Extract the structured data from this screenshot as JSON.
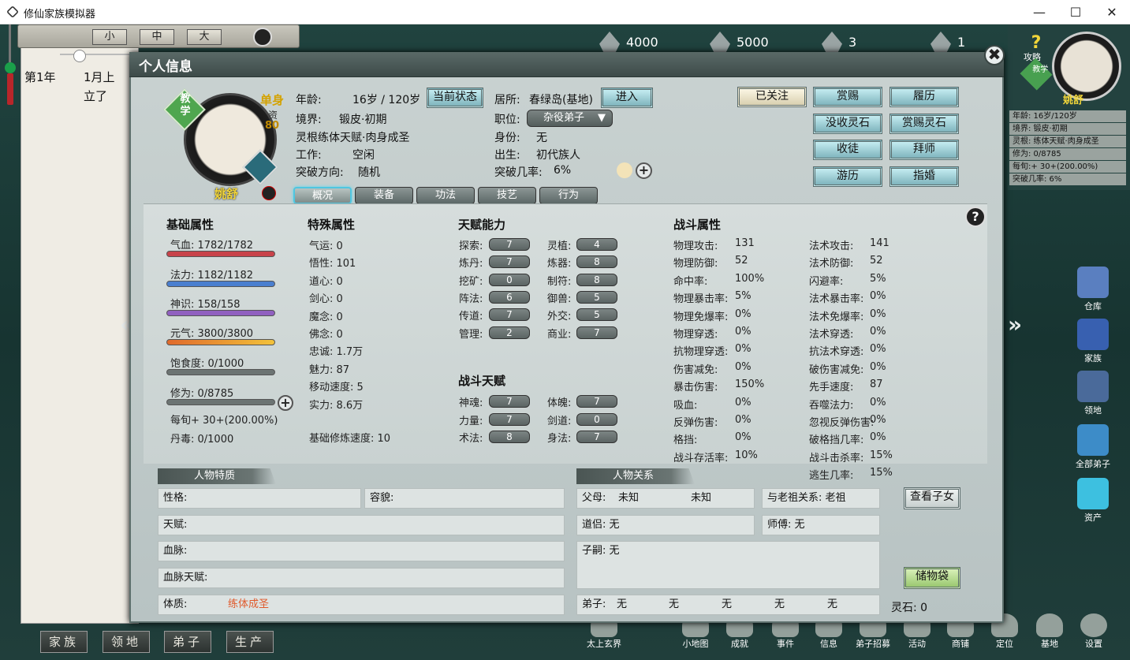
{
  "window": {
    "title": "修仙家族模拟器",
    "min": "—",
    "max": "☐",
    "close": "✕"
  },
  "scroll_sizes": [
    "小",
    "中",
    "大"
  ],
  "log": {
    "year": "第1年",
    "month": "1月上",
    "line2": "立了"
  },
  "bottom_tabs": [
    "家族",
    "领地",
    "弟子",
    "生产"
  ],
  "resources": [
    "4000",
    "5000",
    "3",
    "1"
  ],
  "right_panel": {
    "guide": "攻略",
    "teach": "教学",
    "name": "姚舒",
    "rows": [
      "年龄: 16岁/120岁",
      "境界: 锻皮·初期",
      "灵根: 练体天赋·肉身成圣",
      "修为: 0/8785",
      "每旬:+ 30+(200.00%)",
      "突破几率: 6%"
    ],
    "buttons": [
      "仓库",
      "家族",
      "领地",
      "全部弟子",
      "资产"
    ]
  },
  "bottom_nav": [
    "太上玄界",
    "小地图",
    "成就",
    "事件",
    "信息",
    "弟子招募",
    "活动",
    "商铺",
    "定位",
    "基地",
    "设置"
  ],
  "dialog": {
    "title": "个人信息",
    "close": "✖",
    "portrait": {
      "teach": "教学",
      "marital": "单身",
      "talent_label": "资",
      "talent": "80",
      "name": "姚舒"
    },
    "info": {
      "age_label": "年龄:",
      "age": "16岁 / 120岁",
      "realm_label": "境界:",
      "realm": "锻皮·初期",
      "root": "灵根练体天赋·肉身成圣",
      "work_label": "工作:",
      "work": "空闲",
      "direction_label": "突破方向:",
      "direction": "随机",
      "home_label": "居所:",
      "home": "春绿岛(基地)",
      "post_label": "职位:",
      "post": "杂役弟子",
      "identity_label": "身份:",
      "identity": "无",
      "birth_label": "出生:",
      "birth": "初代族人",
      "chance_label": "突破几率:",
      "chance": "6%"
    },
    "btn_status": "当前状态",
    "btn_enter": "进入",
    "actions": [
      "已关注",
      "赏赐",
      "履历",
      "没收灵石",
      "赏赐灵石",
      "收徒",
      "拜师",
      "游历",
      "指婚"
    ],
    "tabs": [
      "概况",
      "装备",
      "功法",
      "技艺",
      "行为"
    ],
    "help": "?",
    "basic": {
      "title": "基础属性",
      "hp": "气血: 1782/1782",
      "mp": "法力: 1182/1182",
      "sense": "神识: 158/158",
      "vital": "元气: 3800/3800",
      "food": "饱食度: 0/1000",
      "cult": "修为: 0/8785",
      "per": "每旬+ 30+(200.00%)",
      "poison": "丹毒: 0/1000",
      "bar_fill": {
        "hp": 1,
        "mp": 1,
        "sense": 1,
        "vital": 1,
        "food": 0,
        "cult": 0
      }
    },
    "special": {
      "title": "特殊属性",
      "rows": [
        "气运: 0",
        "悟性: 101",
        "道心: 0",
        "剑心: 0",
        "魔念: 0",
        "佛念: 0",
        "忠诚: 1.7万",
        "魅力: 87",
        "移动速度: 5",
        "实力: 8.6万"
      ],
      "speed": "基础修炼速度: 10"
    },
    "talent": {
      "title": "天赋能力",
      "left": [
        [
          "探索:",
          "7"
        ],
        [
          "炼丹:",
          "7"
        ],
        [
          "挖矿:",
          "0"
        ],
        [
          "阵法:",
          "6"
        ],
        [
          "传道:",
          "7"
        ],
        [
          "管理:",
          "2"
        ]
      ],
      "right": [
        [
          "灵植:",
          "4"
        ],
        [
          "炼器:",
          "8"
        ],
        [
          "制符:",
          "8"
        ],
        [
          "御兽:",
          "5"
        ],
        [
          "外交:",
          "5"
        ],
        [
          "商业:",
          "7"
        ]
      ]
    },
    "battle_talent": {
      "title": "战斗天赋",
      "left": [
        [
          "神魂:",
          "7"
        ],
        [
          "力量:",
          "7"
        ],
        [
          "术法:",
          "8"
        ]
      ],
      "right": [
        [
          "体魄:",
          "7"
        ],
        [
          "剑道:",
          "0"
        ],
        [
          "身法:",
          "7"
        ]
      ]
    },
    "combat": {
      "title": "战斗属性",
      "left": [
        [
          "物理攻击:",
          "131"
        ],
        [
          "物理防御:",
          "52"
        ],
        [
          "命中率:",
          "100%"
        ],
        [
          "物理暴击率:",
          "5%"
        ],
        [
          "物理免爆率:",
          "0%"
        ],
        [
          "物理穿透:",
          "0%"
        ],
        [
          "抗物理穿透:",
          "0%"
        ],
        [
          "伤害减免:",
          "0%"
        ],
        [
          "暴击伤害:",
          "150%"
        ],
        [
          "吸血:",
          "0%"
        ],
        [
          "反弹伤害:",
          "0%"
        ],
        [
          "格挡:",
          "0%"
        ],
        [
          "战斗存活率:",
          "10%"
        ]
      ],
      "right": [
        [
          "法术攻击:",
          "141"
        ],
        [
          "法术防御:",
          "52"
        ],
        [
          "闪避率:",
          "5%"
        ],
        [
          "法术暴击率:",
          "0%"
        ],
        [
          "法术免爆率:",
          "0%"
        ],
        [
          "法术穿透:",
          "0%"
        ],
        [
          "抗法术穿透:",
          "0%"
        ],
        [
          "破伤害减免:",
          "0%"
        ],
        [
          "先手速度:",
          "87"
        ],
        [
          "吞噬法力:",
          "0%"
        ],
        [
          "忽视反弹伤害:",
          "0%"
        ],
        [
          "破格挡几率:",
          "0%"
        ],
        [
          "战斗击杀率:",
          "15%"
        ],
        [
          "逃生几率:",
          "15%"
        ]
      ]
    },
    "traits": {
      "header": "人物特质",
      "personality": "性格:",
      "looks": "容貌:",
      "gift": "天赋:",
      "blood": "血脉:",
      "blood_gift": "血脉天赋:",
      "body_label": "体质:",
      "body": "练体成圣"
    },
    "relations": {
      "header": "人物关系",
      "parents_label": "父母:",
      "father": "未知",
      "mother": "未知",
      "ancestor": "与老祖关系:  老祖",
      "partner": "道侣: 无",
      "master": "师傅: 无",
      "heir": "子嗣: 无",
      "disciples_label": "弟子:",
      "disciples": [
        "无",
        "无",
        "无",
        "无",
        "无"
      ],
      "children_btn": "查看子女",
      "bag_btn": "储物袋",
      "stones": "灵石: 0"
    }
  },
  "colors": {
    "hp": "#c8434a",
    "mp": "#4a7fcf",
    "sense": "#9060c0",
    "vital": "#e08a2c",
    "accent": "#4fc6e0",
    "gold": "#f2d63a"
  }
}
